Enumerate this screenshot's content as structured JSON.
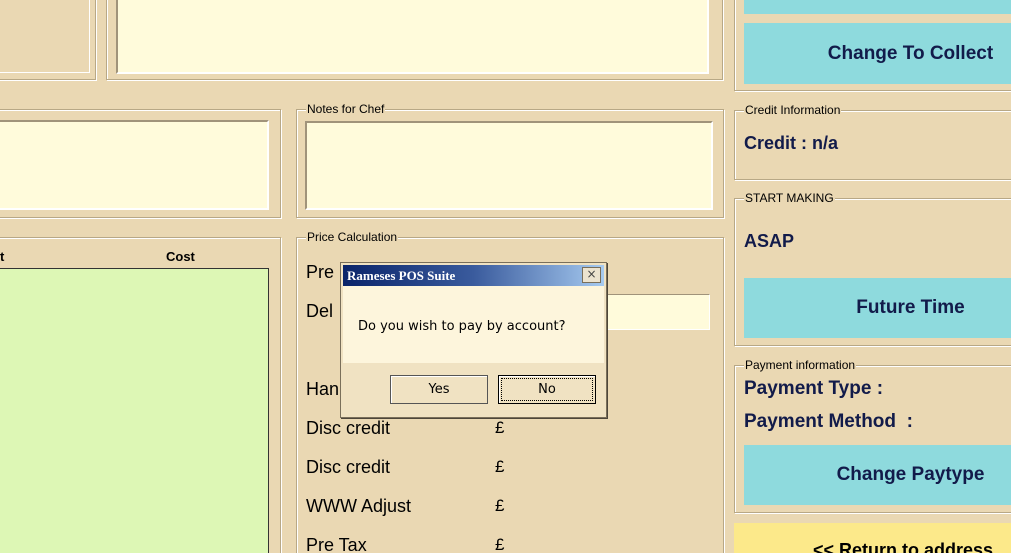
{
  "top": {
    "change_to_collect_label": "Change To Collect"
  },
  "notes_panel": {
    "legend": "Notes for Chef"
  },
  "items_table": {
    "col_item_partial": "t",
    "col_cost": "Cost"
  },
  "price_panel": {
    "legend": "Price Calculation",
    "rows": [
      {
        "label": "Pre",
        "currency": ""
      },
      {
        "label": "Del",
        "currency": ""
      },
      {
        "label": "Han",
        "currency": ""
      },
      {
        "label": "Disc credit",
        "currency": "£"
      },
      {
        "label": "Disc credit",
        "currency": "£"
      },
      {
        "label": "WWW Adjust",
        "currency": "£"
      },
      {
        "label": "Pre Tax",
        "currency": "£"
      }
    ]
  },
  "credit_panel": {
    "legend": "Credit Information",
    "credit_text": "Credit : n/a"
  },
  "start_panel": {
    "legend": "START MAKING",
    "value": "ASAP",
    "future_time_label": "Future Time"
  },
  "payment_panel": {
    "legend": "Payment information",
    "type_label": "Payment Type :",
    "method_label": "Payment Method  :",
    "change_paytype_label": "Change Paytype"
  },
  "return_button_label": "<< Return to address",
  "dialog": {
    "title": "Rameses POS Suite",
    "close_glyph": "×",
    "message": "Do you wish to pay by account?",
    "yes_label": "Yes",
    "no_label": "No"
  },
  "colors": {
    "background": "#ead8b3",
    "input_box": "#fffbdb",
    "action_button": "#8edadd",
    "button_text": "#121b4a",
    "list_area": "#ddf7b5",
    "return_button": "#fce98a"
  }
}
